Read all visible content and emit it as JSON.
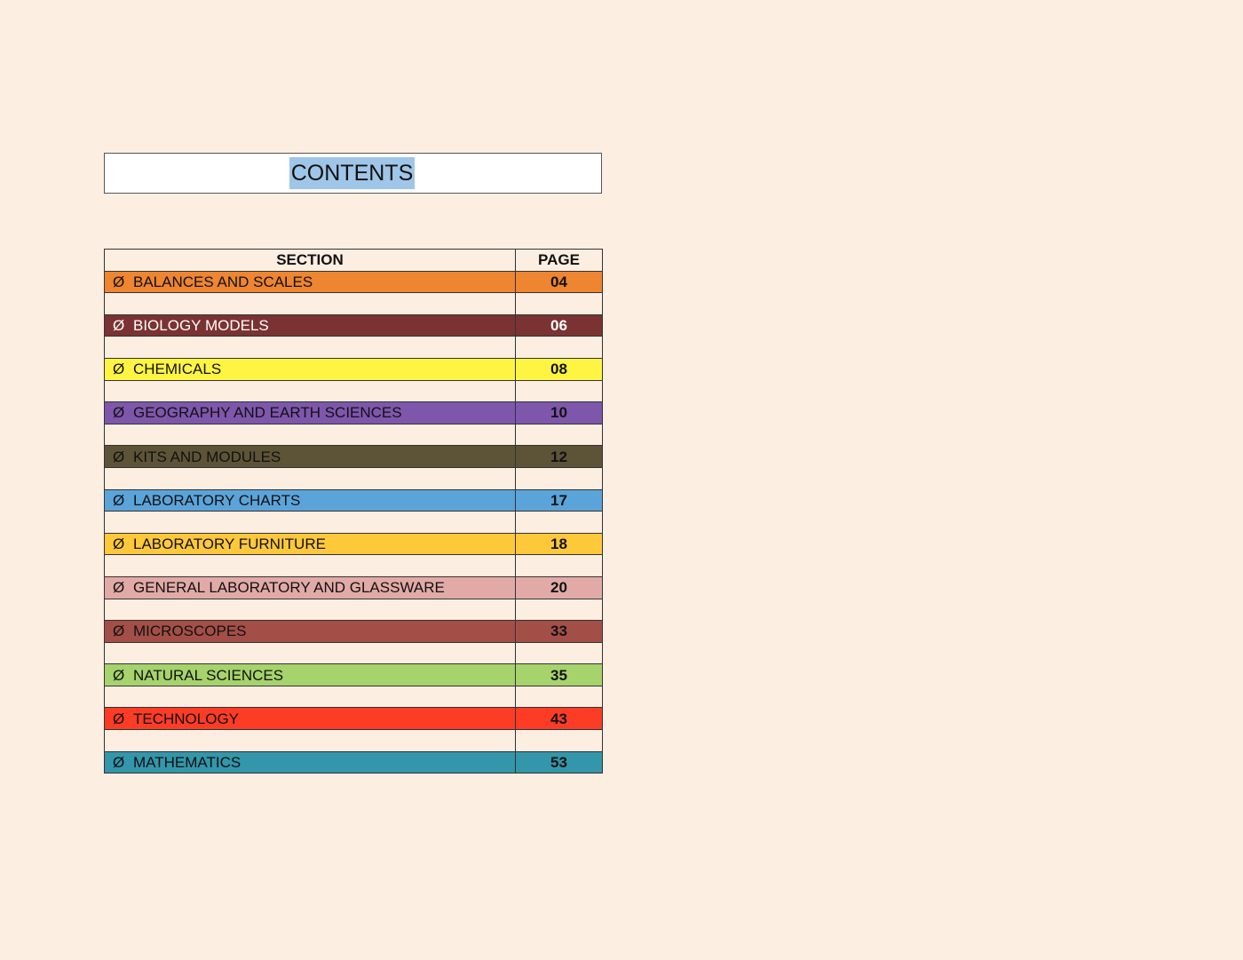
{
  "title": "CONTENTS",
  "table": {
    "headers": {
      "section": "SECTION",
      "page": "PAGE"
    },
    "bullet_symbol": "Ø",
    "rows": [
      {
        "section": "BALANCES AND SCALES",
        "page": "04",
        "color": "#ee8531",
        "light_text": false
      },
      {
        "section": "BIOLOGY MODELS",
        "page": "06",
        "color": "#7a3332",
        "light_text": true
      },
      {
        "section": "CHEMICALS",
        "page": "08",
        "color": "#fef543",
        "light_text": false
      },
      {
        "section": "GEOGRAPHY AND EARTH SCIENCES",
        "page": "10",
        "color": "#7e57ac",
        "light_text": false
      },
      {
        "section": "KITS AND MODULES",
        "page": "12",
        "color": "#5d5337",
        "light_text": false
      },
      {
        "section": "LABORATORY CHARTS",
        "page": "17",
        "color": "#5ba4da",
        "light_text": false
      },
      {
        "section": "LABORATORY FURNITURE",
        "page": "18",
        "color": "#fec83b",
        "light_text": false
      },
      {
        "section": "GENERAL LABORATORY AND GLASSWARE",
        "page": "20",
        "color": "#e2aaa7",
        "light_text": false
      },
      {
        "section": "MICROSCOPES",
        "page": "33",
        "color": "#a44e48",
        "light_text": false
      },
      {
        "section": "NATURAL SCIENCES",
        "page": "35",
        "color": "#a6d36b",
        "light_text": false
      },
      {
        "section": "TECHNOLOGY",
        "page": "43",
        "color": "#fd3c26",
        "light_text": false
      },
      {
        "section": "MATHEMATICS",
        "page": "53",
        "color": "#3396aa",
        "light_text": false
      }
    ]
  }
}
